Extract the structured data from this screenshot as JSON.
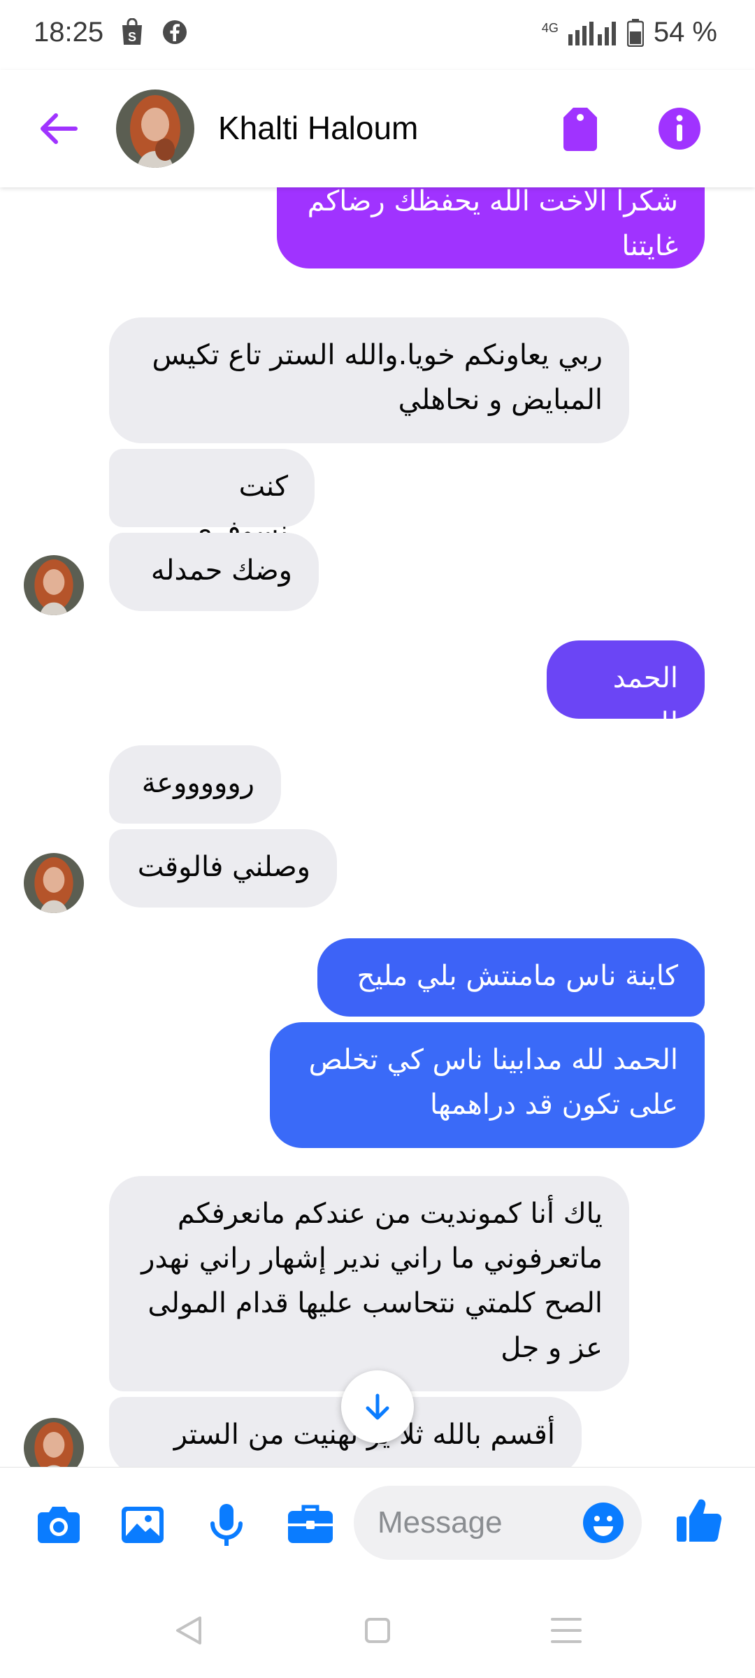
{
  "status_bar": {
    "time": "18:25",
    "battery": "54 %",
    "network": "4G",
    "icons": [
      "shopping-bag-icon",
      "facebook-icon",
      "signal-icon",
      "battery-icon"
    ]
  },
  "header": {
    "contact_name": "Khalti Haloum",
    "accent": "#a033ff",
    "icons": [
      "back-arrow-icon",
      "tag-icon",
      "info-icon"
    ]
  },
  "messages": [
    {
      "side": "out",
      "text": "شكرا الاخت الله يحفظك رضاكم غايتنا",
      "color": "#a033ff"
    },
    {
      "side": "in",
      "text": "ربي يعاونكم خويا.والله الستر تاع تكيس المبايض و نحاهلي"
    },
    {
      "side": "in",
      "text": "كنت نسوفري"
    },
    {
      "side": "in",
      "text": "وضك حمدله"
    },
    {
      "side": "out",
      "text": "الحمد لله",
      "color": "#6b45f5"
    },
    {
      "side": "in",
      "text": "روووووعة"
    },
    {
      "side": "in",
      "text": "وصلني فالوقت"
    },
    {
      "side": "out",
      "text": "كاينة ناس مامنتش بلي مليح",
      "color": "#3d63f7"
    },
    {
      "side": "out",
      "text": "الحمد لله مدابينا ناس كي تخلص على تكون قد دراهمها",
      "color": "#3a6af8"
    },
    {
      "side": "in",
      "text": "ياك أنا كمونديت من عندكم مانعرفكم ماتعرفوني ما راني ندير إشهار راني نهدر الصح كلمتي نتحاسب عليها قدام المولى عز و جل"
    },
    {
      "side": "in",
      "text": "أقسم بالله ثلاث مرات من الستر تهنيت من الستر"
    }
  ],
  "last_message_visible": "أقسم بالله ثلا    ير تهنيت من الستر",
  "composer": {
    "placeholder": "Message",
    "accent": "#0a7cff",
    "icons": [
      "camera-icon",
      "image-icon",
      "microphone-icon",
      "briefcase-icon",
      "emoji-icon",
      "thumbs-up-icon"
    ]
  },
  "navbar": {
    "icons": [
      "back-triangle-icon",
      "home-square-icon",
      "menu-lines-icon"
    ]
  }
}
